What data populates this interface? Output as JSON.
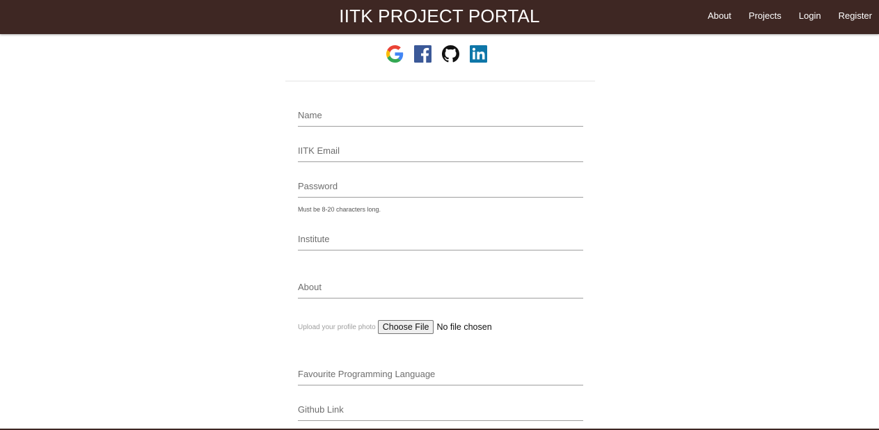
{
  "navbar": {
    "brand": "IITK PROJECT PORTAL",
    "links": [
      "About",
      "Projects",
      "Login",
      "Register"
    ],
    "background": "#3e2723"
  },
  "social": {
    "icons": [
      "google-icon",
      "facebook-icon",
      "github-icon",
      "linkedin-icon"
    ]
  },
  "form": {
    "name_placeholder": "Name",
    "email_placeholder": "IITK Email",
    "password_placeholder": "Password",
    "password_hint": "Must be 8-20 characters long.",
    "institute_placeholder": "Institute",
    "about_placeholder": "About",
    "upload_label": "Upload your profile photo",
    "choose_file_label": "Choose File",
    "file_status": "No file chosen",
    "language_placeholder": "Favourite Programming Language",
    "github_placeholder": "Github Link"
  }
}
